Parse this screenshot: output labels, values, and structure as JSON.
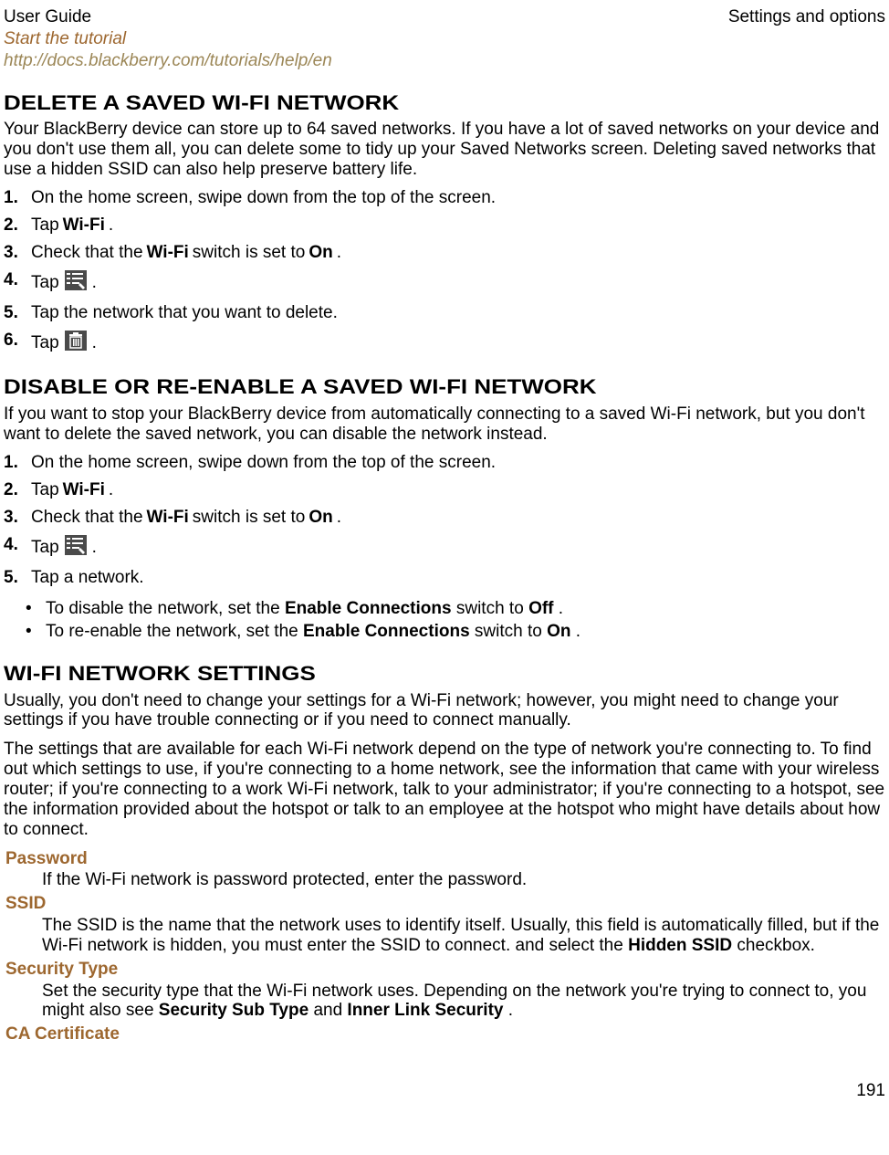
{
  "header": {
    "left": "User Guide",
    "right": "Settings and options"
  },
  "links": {
    "tutorial": "Start the tutorial",
    "url": "http://docs.blackberry.com/tutorials/help/en"
  },
  "section1": {
    "heading": "Delete a saved Wi-Fi network",
    "intro": "Your BlackBerry device can store up to 64 saved networks. If you have a lot of saved networks on your device and you don't use them all, you can delete some to tidy up your Saved Networks screen. Deleting saved networks that use a hidden SSID can also help preserve battery life.",
    "steps": {
      "n1": "1.",
      "s1": "On the home screen, swipe down from the top of the screen.",
      "n2": "2.",
      "s2a": "Tap ",
      "s2b": "Wi-Fi",
      "s2c": " .",
      "n3": "3.",
      "s3a": "Check that the ",
      "s3b": "Wi-Fi",
      "s3c": " switch is set to ",
      "s3d": "On",
      "s3e": ".",
      "n4": "4.",
      "s4a": "Tap ",
      "s4b": ".",
      "n5": "5.",
      "s5": "Tap the network that you want to delete.",
      "n6": "6.",
      "s6a": "Tap ",
      "s6b": "."
    }
  },
  "section2": {
    "heading": "Disable or re-enable a saved Wi-Fi network",
    "intro": "If you want to stop your BlackBerry device from automatically connecting to a saved Wi-Fi network, but you don't want to delete the saved network, you can disable the network instead.",
    "steps": {
      "n1": "1.",
      "s1": "On the home screen, swipe down from the top of the screen.",
      "n2": "2.",
      "s2a": "Tap ",
      "s2b": "Wi-Fi",
      "s2c": ".",
      "n3": "3.",
      "s3a": "Check that the ",
      "s3b": "Wi-Fi",
      "s3c": " switch is set to ",
      "s3d": "On",
      "s3e": ".",
      "n4": "4.",
      "s4a": "Tap ",
      "s4b": ".",
      "n5": "5.",
      "s5": "Tap a network."
    },
    "bullets": {
      "b1a": "To disable the network, set the ",
      "b1b": "Enable Connections",
      "b1c": " switch to ",
      "b1d": "Off",
      "b1e": ".",
      "b2a": "To re-enable the network, set the ",
      "b2b": "Enable Connections",
      "b2c": " switch to ",
      "b2d": "On",
      "b2e": "."
    }
  },
  "section3": {
    "heading": "Wi-Fi network settings",
    "p1": "Usually, you don't need to change your settings for a Wi-Fi network; however, you might need to change your settings if you have trouble connecting or if you need to connect manually.",
    "p2": "The settings that are available for each Wi-Fi network depend on the type of network you're connecting to. To find out which settings to use, if you're connecting to a home network, see the information that came with your wireless router; if you're connecting to a work Wi-Fi network, talk to your administrator; if you're connecting to a hotspot, see the information provided about the hotspot or talk to an employee at the hotspot who might have details about how to connect.",
    "defs": {
      "t1": "Password",
      "d1": "If the Wi-Fi network is password protected, enter the password.",
      "t2": "SSID",
      "d2a": "The SSID is the name that the network uses to identify itself. Usually, this field is automatically filled, but if the Wi-Fi network is hidden, you must enter the SSID to connect. and select the ",
      "d2b": "Hidden SSID",
      "d2c": " checkbox.",
      "t3": "Security Type",
      "d3a": "Set the security type that the Wi-Fi network uses. Depending on the network you're trying to connect to, you might also see ",
      "d3b": "Security Sub Type",
      "d3c": " and ",
      "d3d": "Inner Link Security",
      "d3e": ".",
      "t4": "CA Certificate"
    }
  },
  "page_number": "191"
}
